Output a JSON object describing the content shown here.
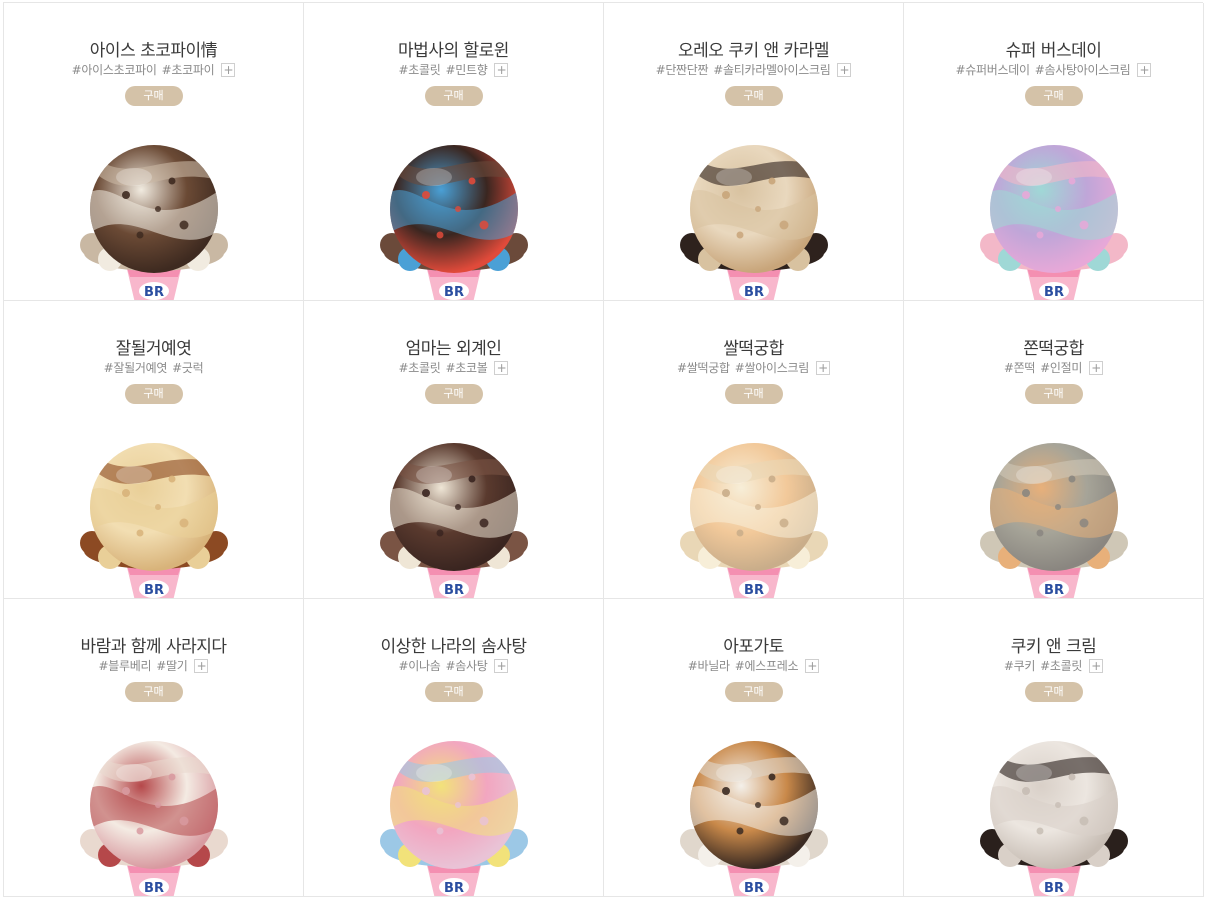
{
  "products": [
    {
      "name": "아이스 초코파이情",
      "tags": [
        "#아이스초코파이",
        "#초코파이"
      ],
      "has_more": true,
      "buy_label": "구매",
      "colors": [
        "#6b4a35",
        "#f1ebe0",
        "#c9b8a3",
        "#3e2a20"
      ]
    },
    {
      "name": "마법사의 할로윈",
      "tags": [
        "#초콜릿",
        "#민트향"
      ],
      "has_more": true,
      "buy_label": "구매",
      "colors": [
        "#3a2620",
        "#4aa0d6",
        "#6b4a3a",
        "#e04a3a"
      ]
    },
    {
      "name": "오레오 쿠키 앤 카라멜",
      "tags": [
        "#단짠단짠",
        "#솔티카라멜아이스크림"
      ],
      "has_more": true,
      "buy_label": "구매",
      "colors": [
        "#e9d8be",
        "#d8c2a0",
        "#2e221d",
        "#c8a57a"
      ]
    },
    {
      "name": "슈퍼 버스데이",
      "tags": [
        "#슈퍼버스데이",
        "#솜사탕아이스크림"
      ],
      "has_more": true,
      "buy_label": "구매",
      "colors": [
        "#bfa6d8",
        "#9fd8d6",
        "#f3b8c8",
        "#e7a8d8"
      ]
    },
    {
      "name": "잘될거예엿",
      "tags": [
        "#잘될거예엿",
        "#긋럭"
      ],
      "has_more": false,
      "buy_label": "구매",
      "colors": [
        "#f2deb2",
        "#e9cf98",
        "#8c4a23",
        "#d8b37a"
      ]
    },
    {
      "name": "엄마는 외계인",
      "tags": [
        "#초콜릿",
        "#초코볼"
      ],
      "has_more": true,
      "buy_label": "구매",
      "colors": [
        "#5a3a2e",
        "#efe6d6",
        "#7a5444",
        "#3a2520"
      ]
    },
    {
      "name": "쌀떡궁합",
      "tags": [
        "#쌀떡궁합",
        "#쌀아이스크림"
      ],
      "has_more": true,
      "buy_label": "구매",
      "colors": [
        "#f2c99a",
        "#f7eed8",
        "#e9d7b6",
        "#c9ad8a"
      ]
    },
    {
      "name": "쫀떡궁합",
      "tags": [
        "#쫀떡",
        "#인절미"
      ],
      "has_more": true,
      "buy_label": "구매",
      "colors": [
        "#a6a498",
        "#e8b07a",
        "#cfc7b6",
        "#8a8680"
      ]
    },
    {
      "name": "바람과 함께 사라지다",
      "tags": [
        "#블루베리",
        "#딸기"
      ],
      "has_more": true,
      "buy_label": "구매",
      "colors": [
        "#f4ebe3",
        "#b5484a",
        "#e9d9cf",
        "#d89aa0"
      ]
    },
    {
      "name": "이상한 나라의 솜사탕",
      "tags": [
        "#이나솜",
        "#솜사탕"
      ],
      "has_more": true,
      "buy_label": "구매",
      "colors": [
        "#f2a6c0",
        "#f2e27a",
        "#9cc8e6",
        "#e9c3d6"
      ]
    },
    {
      "name": "아포가토",
      "tags": [
        "#바닐라",
        "#에스프레소"
      ],
      "has_more": true,
      "buy_label": "구매",
      "colors": [
        "#c9894a",
        "#f4f0ea",
        "#e0d7cc",
        "#3a2a22"
      ]
    },
    {
      "name": "쿠키 앤 크림",
      "tags": [
        "#쿠키",
        "#초콜릿"
      ],
      "has_more": true,
      "buy_label": "구매",
      "colors": [
        "#ece6e0",
        "#d9d0c8",
        "#2a201c",
        "#c7bdb4"
      ]
    }
  ],
  "cone": {
    "pink": "#f48fb1",
    "pink_light": "#f8b7cc",
    "logo_blue": "#2b4ea0",
    "logo_pink": "#e03f7c",
    "logo_text": "BR"
  },
  "more_symbol": "+"
}
